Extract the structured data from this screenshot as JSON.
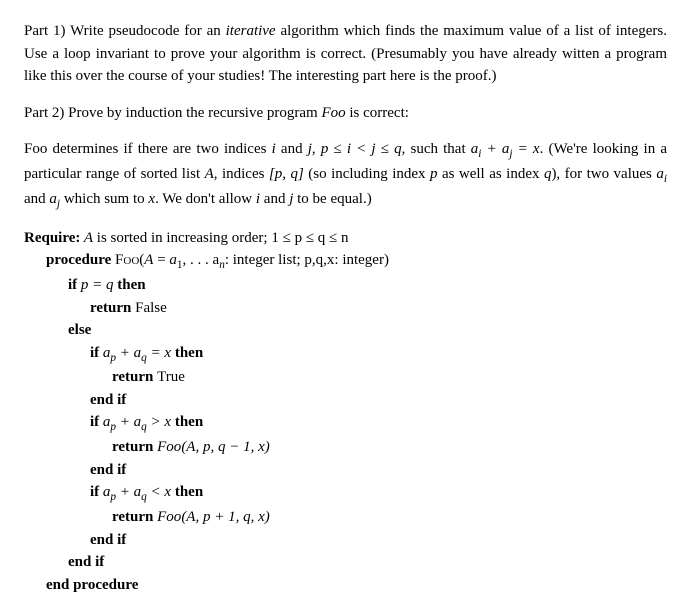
{
  "part1": {
    "label": "Part 1) ",
    "text1": "Write pseudocode for an ",
    "italic1": "iterative",
    "text2": " algorithm which finds the maximum value of a list of integers. Use a loop invariant to prove your algorithm is correct. (Presumably you have already witten a program like this over the course of your studies! The interesting part here is the proof.)"
  },
  "part2": {
    "label": "Part 2) ",
    "text1": "Prove by induction the recursive program ",
    "foo": "Foo",
    "text2": " is correct:"
  },
  "desc": {
    "text1": "Foo determines if there are two indices ",
    "i": "i",
    "and1": " and ",
    "j": "j",
    "comma1": ", ",
    "cond": "p ≤ i < j ≤ q",
    "such": ", such that ",
    "sum": "a",
    "sub_i": "i",
    "plus": " + a",
    "sub_j": "j",
    "eqx": " = x",
    "dot1": ". (We're looking in a particular range of sorted list ",
    "A": "A",
    "text2": ", indices ",
    "range": "[p, q]",
    "text3": " (so including index ",
    "p": "p",
    "text4": " as well as index ",
    "q": "q",
    "text5": "), for two values ",
    "ai": "a",
    "ai_sub": "i",
    "and2": " and ",
    "aj": "a",
    "aj_sub": "j",
    "text6": " which sum to ",
    "x": "x",
    "text7": ". We don't allow ",
    "i2": "i",
    "and3": " and ",
    "j2": "j",
    "text8": " to be equal.)"
  },
  "algo": {
    "require_label": "Require:",
    "require_text1": " A",
    "require_text2": " is sorted in increasing order; ",
    "require_cond": "1 ≤ p ≤ q ≤ n",
    "proc_label": "procedure ",
    "proc_name": "Foo",
    "proc_args": "(A = a",
    "proc_sub1": "1",
    "proc_args2": ", . . . a",
    "proc_subn": "n",
    "proc_args3": ": integer list; p,q,x: integer)",
    "if1": "if ",
    "if1_cond": "p = q",
    "then": " then",
    "ret_false": "return ",
    "false_val": "False",
    "else": "else",
    "if2": "if ",
    "if2_cond_a": "a",
    "if2_sub_p": "p",
    "if2_plus": " + a",
    "if2_sub_q": "q",
    "if2_eq": " = x",
    "ret_true": "return ",
    "true_val": "True",
    "endif": "end if",
    "if3_gt": " > x",
    "ret_foo1": "return ",
    "foo_call1_name": "Foo",
    "foo_call1_args": "(A, p, q − 1, x)",
    "if4_lt": " < x",
    "foo_call2_args": "(A, p + 1, q, x)",
    "endproc": "end procedure"
  }
}
